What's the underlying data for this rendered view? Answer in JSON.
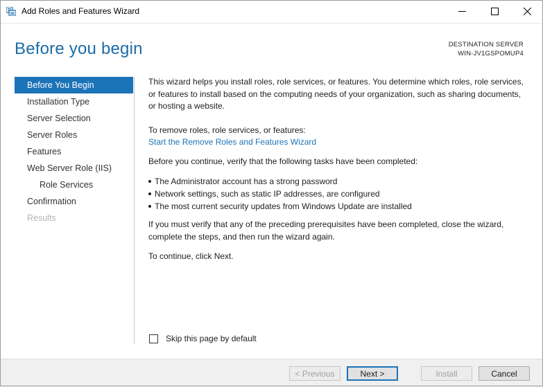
{
  "window": {
    "title": "Add Roles and Features Wizard"
  },
  "header": {
    "page_title": "Before you begin",
    "destination_label": "DESTINATION SERVER",
    "destination_server": "WIN-JV1GSPOMUP4"
  },
  "nav": {
    "items": [
      {
        "label": "Before You Begin",
        "state": "active"
      },
      {
        "label": "Installation Type",
        "state": "normal"
      },
      {
        "label": "Server Selection",
        "state": "normal"
      },
      {
        "label": "Server Roles",
        "state": "normal"
      },
      {
        "label": "Features",
        "state": "normal"
      },
      {
        "label": "Web Server Role (IIS)",
        "state": "normal"
      },
      {
        "label": "Role Services",
        "state": "sub"
      },
      {
        "label": "Confirmation",
        "state": "normal"
      },
      {
        "label": "Results",
        "state": "disabled"
      }
    ]
  },
  "content": {
    "intro": "This wizard helps you install roles, role services, or features. You determine which roles, role services, or features to install based on the computing needs of your organization, such as sharing documents, or hosting a website.",
    "remove_label": "To remove roles, role services, or features:",
    "remove_link": "Start the Remove Roles and Features Wizard",
    "verify": "Before you continue, verify that the following tasks have been completed:",
    "tasks": [
      "The Administrator account has a strong password",
      "Network settings, such as static IP addresses, are configured",
      "The most current security updates from Windows Update are installed"
    ],
    "prereq": "If you must verify that any of the preceding prerequisites have been completed, close the wizard, complete the steps, and then run the wizard again.",
    "continue": "To continue, click Next."
  },
  "skip": {
    "label": "Skip this page by default",
    "checked": false
  },
  "footer": {
    "previous": "< Previous",
    "next": "Next >",
    "install": "Install",
    "cancel": "Cancel"
  },
  "colors": {
    "accent": "#1b73b8",
    "title_blue": "#1b6ca8",
    "disabled_text": "#b4b4b4"
  }
}
